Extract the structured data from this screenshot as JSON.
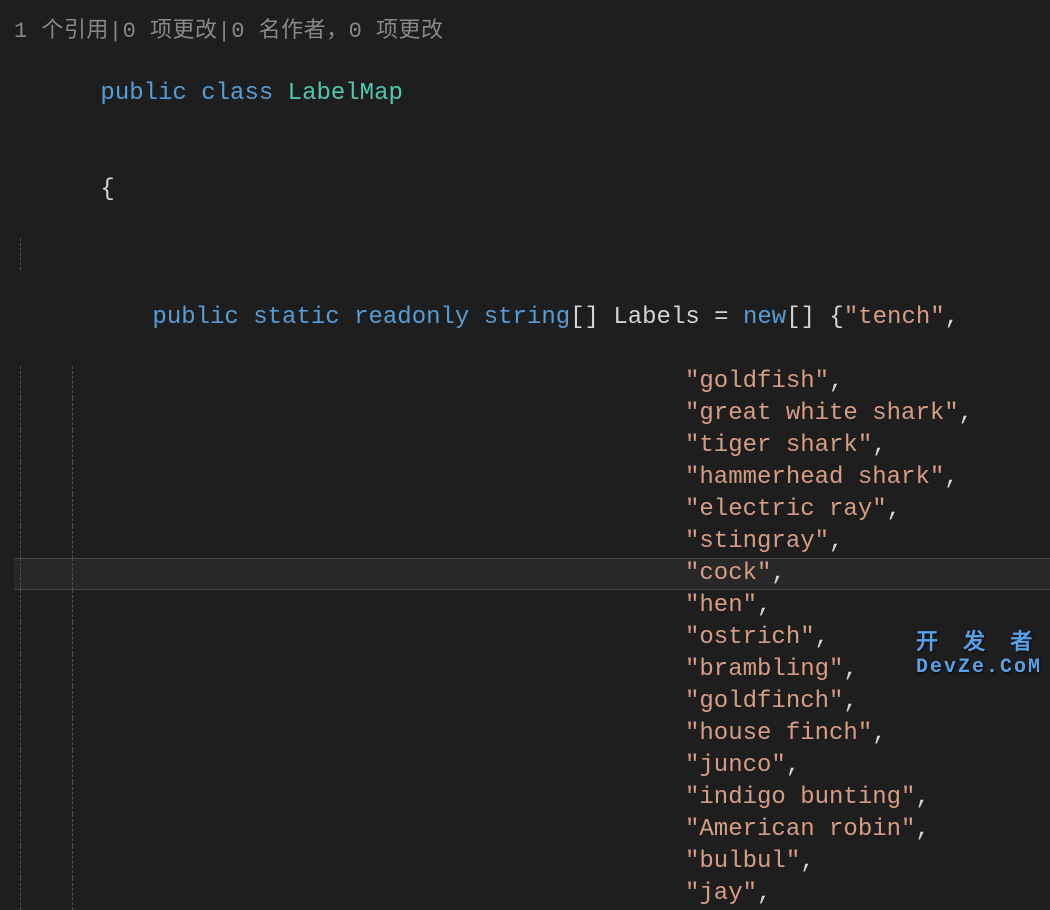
{
  "codelens": {
    "references": "1 个引用",
    "changes1": "0 项更改",
    "authors": "0 名作者",
    "changes2": "0 项更改",
    "separator1": "|",
    "separator2": "|",
    "comma": "，"
  },
  "code": {
    "kw_public": "public",
    "kw_class": "class",
    "classname": "LabelMap",
    "open_brace": "{",
    "kw_public2": "public",
    "kw_static": "static",
    "kw_readonly": "readonly",
    "type_string": "string",
    "brackets": "[]",
    "identifier": "Labels",
    "equals": "=",
    "kw_new": "new",
    "brackets2": "[]",
    "open_brace2": "{",
    "labels": [
      "\"tench\"",
      "\"goldfish\"",
      "\"great white shark\"",
      "\"tiger shark\"",
      "\"hammerhead shark\"",
      "\"electric ray\"",
      "\"stingray\"",
      "\"cock\"",
      "\"hen\"",
      "\"ostrich\"",
      "\"brambling\"",
      "\"goldfinch\"",
      "\"house finch\"",
      "\"junco\"",
      "\"indigo bunting\"",
      "\"American robin\"",
      "\"bulbul\"",
      "\"jay\""
    ],
    "comma": ","
  },
  "watermark": {
    "line1": "开 发 者",
    "line2": "DevZe.CoM"
  },
  "highlighted_line_index": 7
}
